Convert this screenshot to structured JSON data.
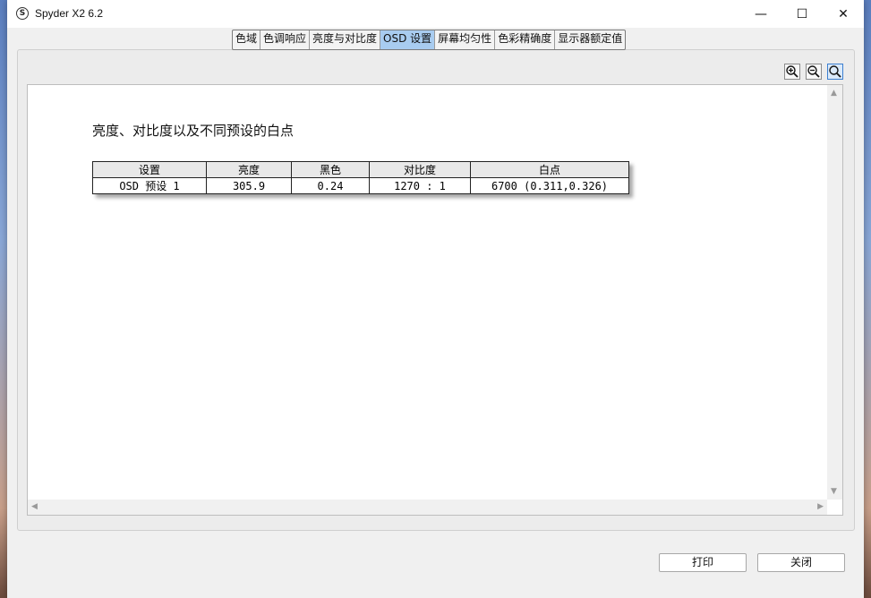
{
  "window": {
    "title": "Spyder X2 6.2",
    "app_icon_letter": "S",
    "minimize_glyph": "—",
    "maximize_glyph": "☐",
    "close_glyph": "✕"
  },
  "tabs": [
    {
      "label": "色域",
      "active": false
    },
    {
      "label": "色调响应",
      "active": false
    },
    {
      "label": "亮度与对比度",
      "active": false
    },
    {
      "label": "OSD 设置",
      "active": true
    },
    {
      "label": "屏幕均匀性",
      "active": false
    },
    {
      "label": "色彩精确度",
      "active": false
    },
    {
      "label": "显示器额定值",
      "active": false
    }
  ],
  "zoom_tools": [
    "zoom-in-icon",
    "zoom-out-icon",
    "zoom-fit-icon"
  ],
  "report": {
    "title": "亮度、对比度以及不同预设的白点",
    "columns": [
      "设置",
      "亮度",
      "黑色",
      "对比度",
      "白点"
    ],
    "rows": [
      [
        "OSD 预设 1",
        "305.9",
        "0.24",
        "1270 : 1",
        "6700 (0.311,0.326)"
      ]
    ]
  },
  "buttons": {
    "print": "打印",
    "close": "关闭"
  },
  "colors": {
    "active_tab": "#a8ccf0",
    "window_bg": "#f0f0f0"
  }
}
